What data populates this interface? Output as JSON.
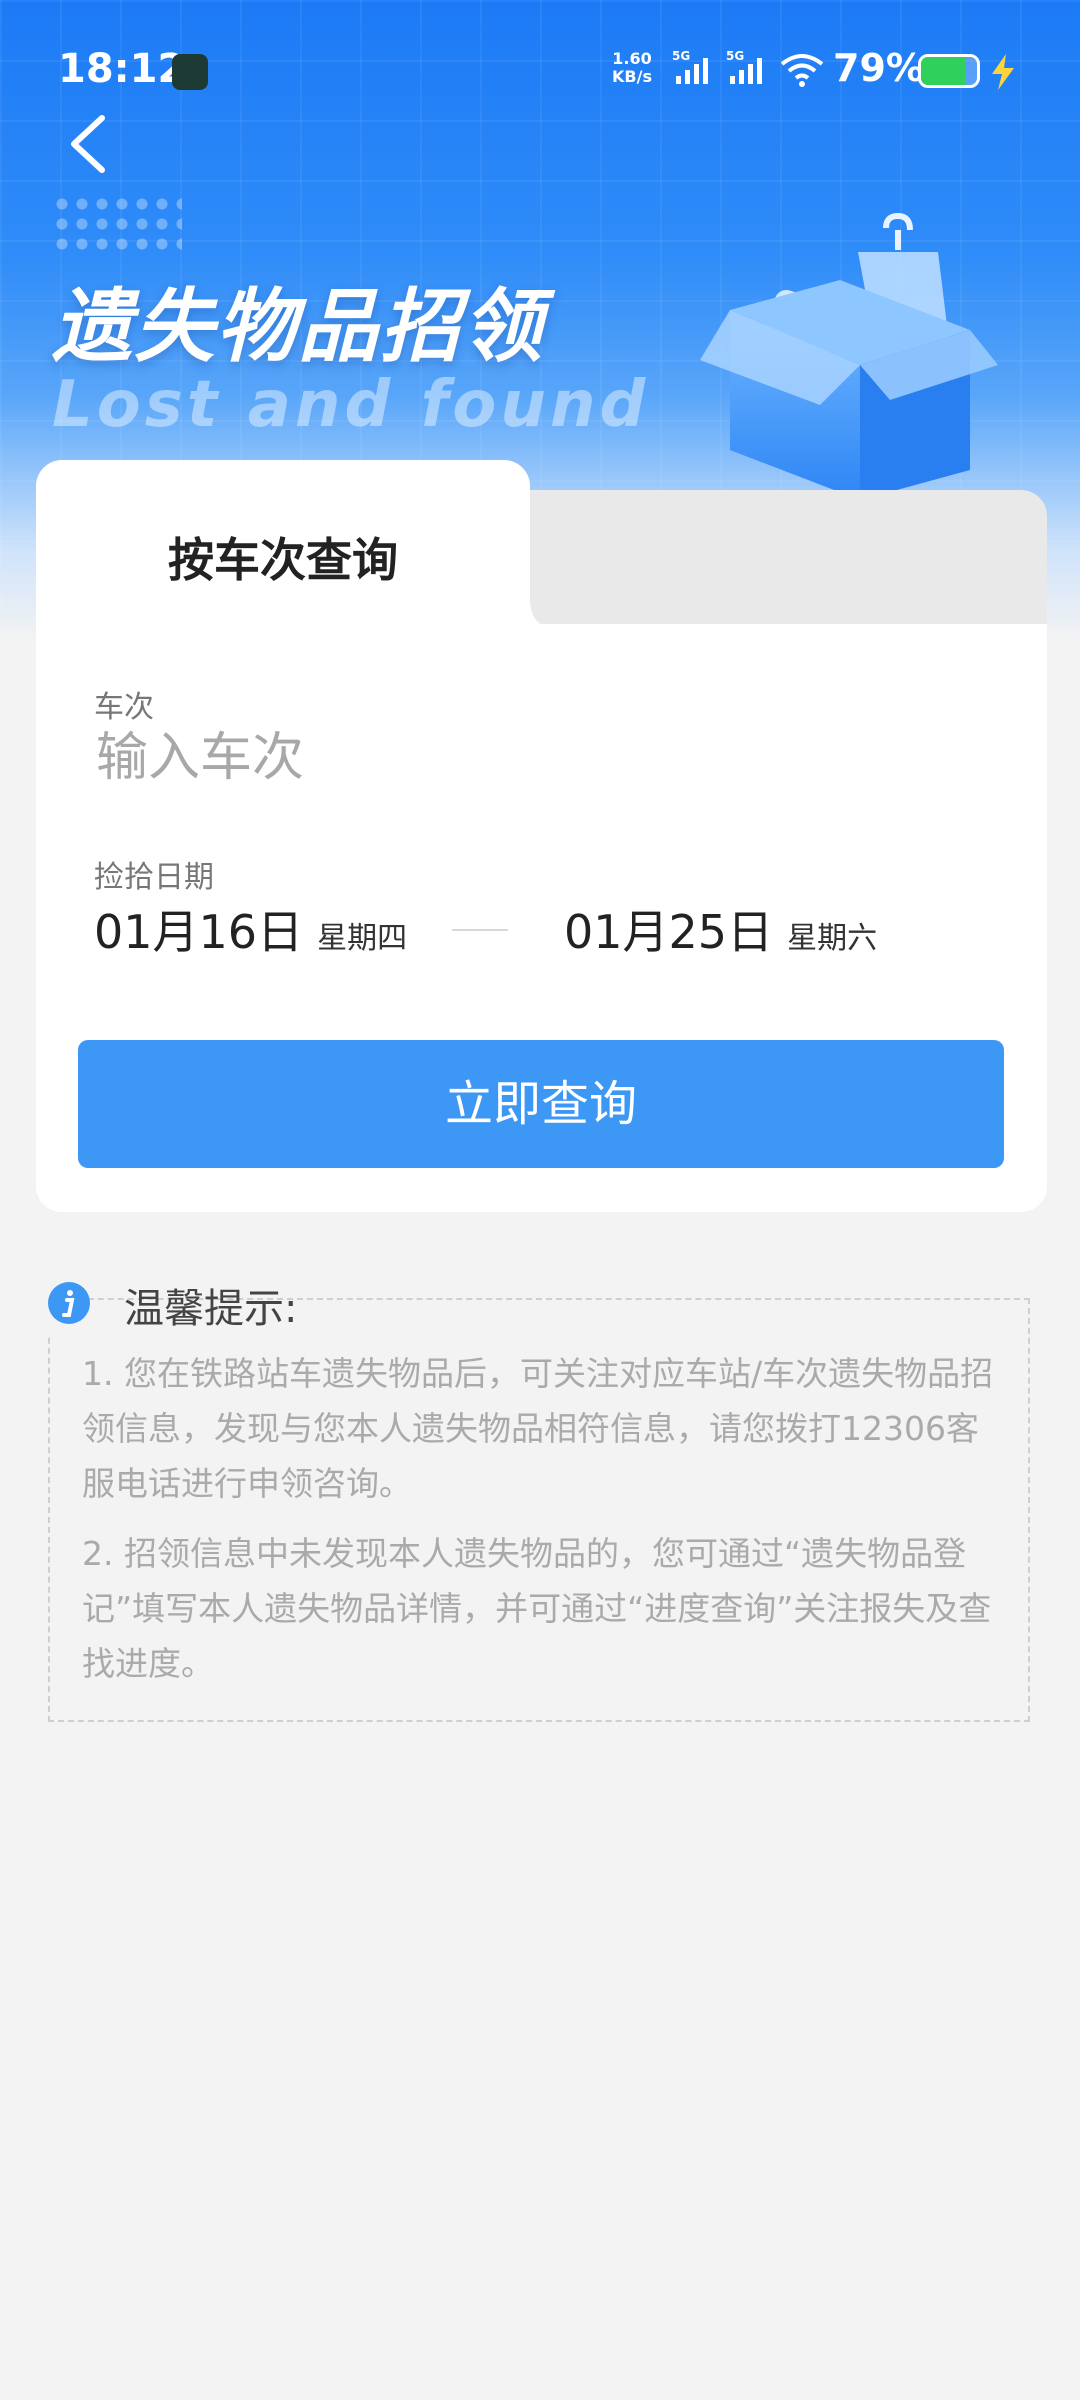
{
  "status_bar": {
    "time": "18:12",
    "net_speed_value": "1.60",
    "net_speed_unit": "KB/s",
    "sim1": "5G",
    "sim2": "5G",
    "battery": "79%",
    "battery_level": 0.79
  },
  "header": {
    "title": "遗失物品招领",
    "subtitle": "Lost and found"
  },
  "tabs": [
    {
      "label": "按车次查询",
      "active": true
    },
    {
      "label": "",
      "active": false
    }
  ],
  "form": {
    "train_label": "车次",
    "train_placeholder": "输入车次",
    "train_value": "",
    "date_label": "捡拾日期",
    "start_date": "01月16日",
    "start_dow": "星期四",
    "end_date": "01月25日",
    "end_dow": "星期六",
    "submit_label": "立即查询"
  },
  "tips": {
    "title": "温馨提示:",
    "items": [
      "1. 您在铁路站车遗失物品后，可关注对应车站/车次遗失物品招领信息，发现与您本人遗失物品相符信息，请您拨打12306客服电话进行申领咨询。",
      "2. 招领信息中未发现本人遗失物品的，您可通过“遗失物品登记”填写本人遗失物品详情，并可通过“进度查询”关注报失及查找进度。"
    ]
  },
  "colors": {
    "brand": "#1c7af6",
    "button": "#3d97f4",
    "battery_fill": "#2fd05b"
  }
}
